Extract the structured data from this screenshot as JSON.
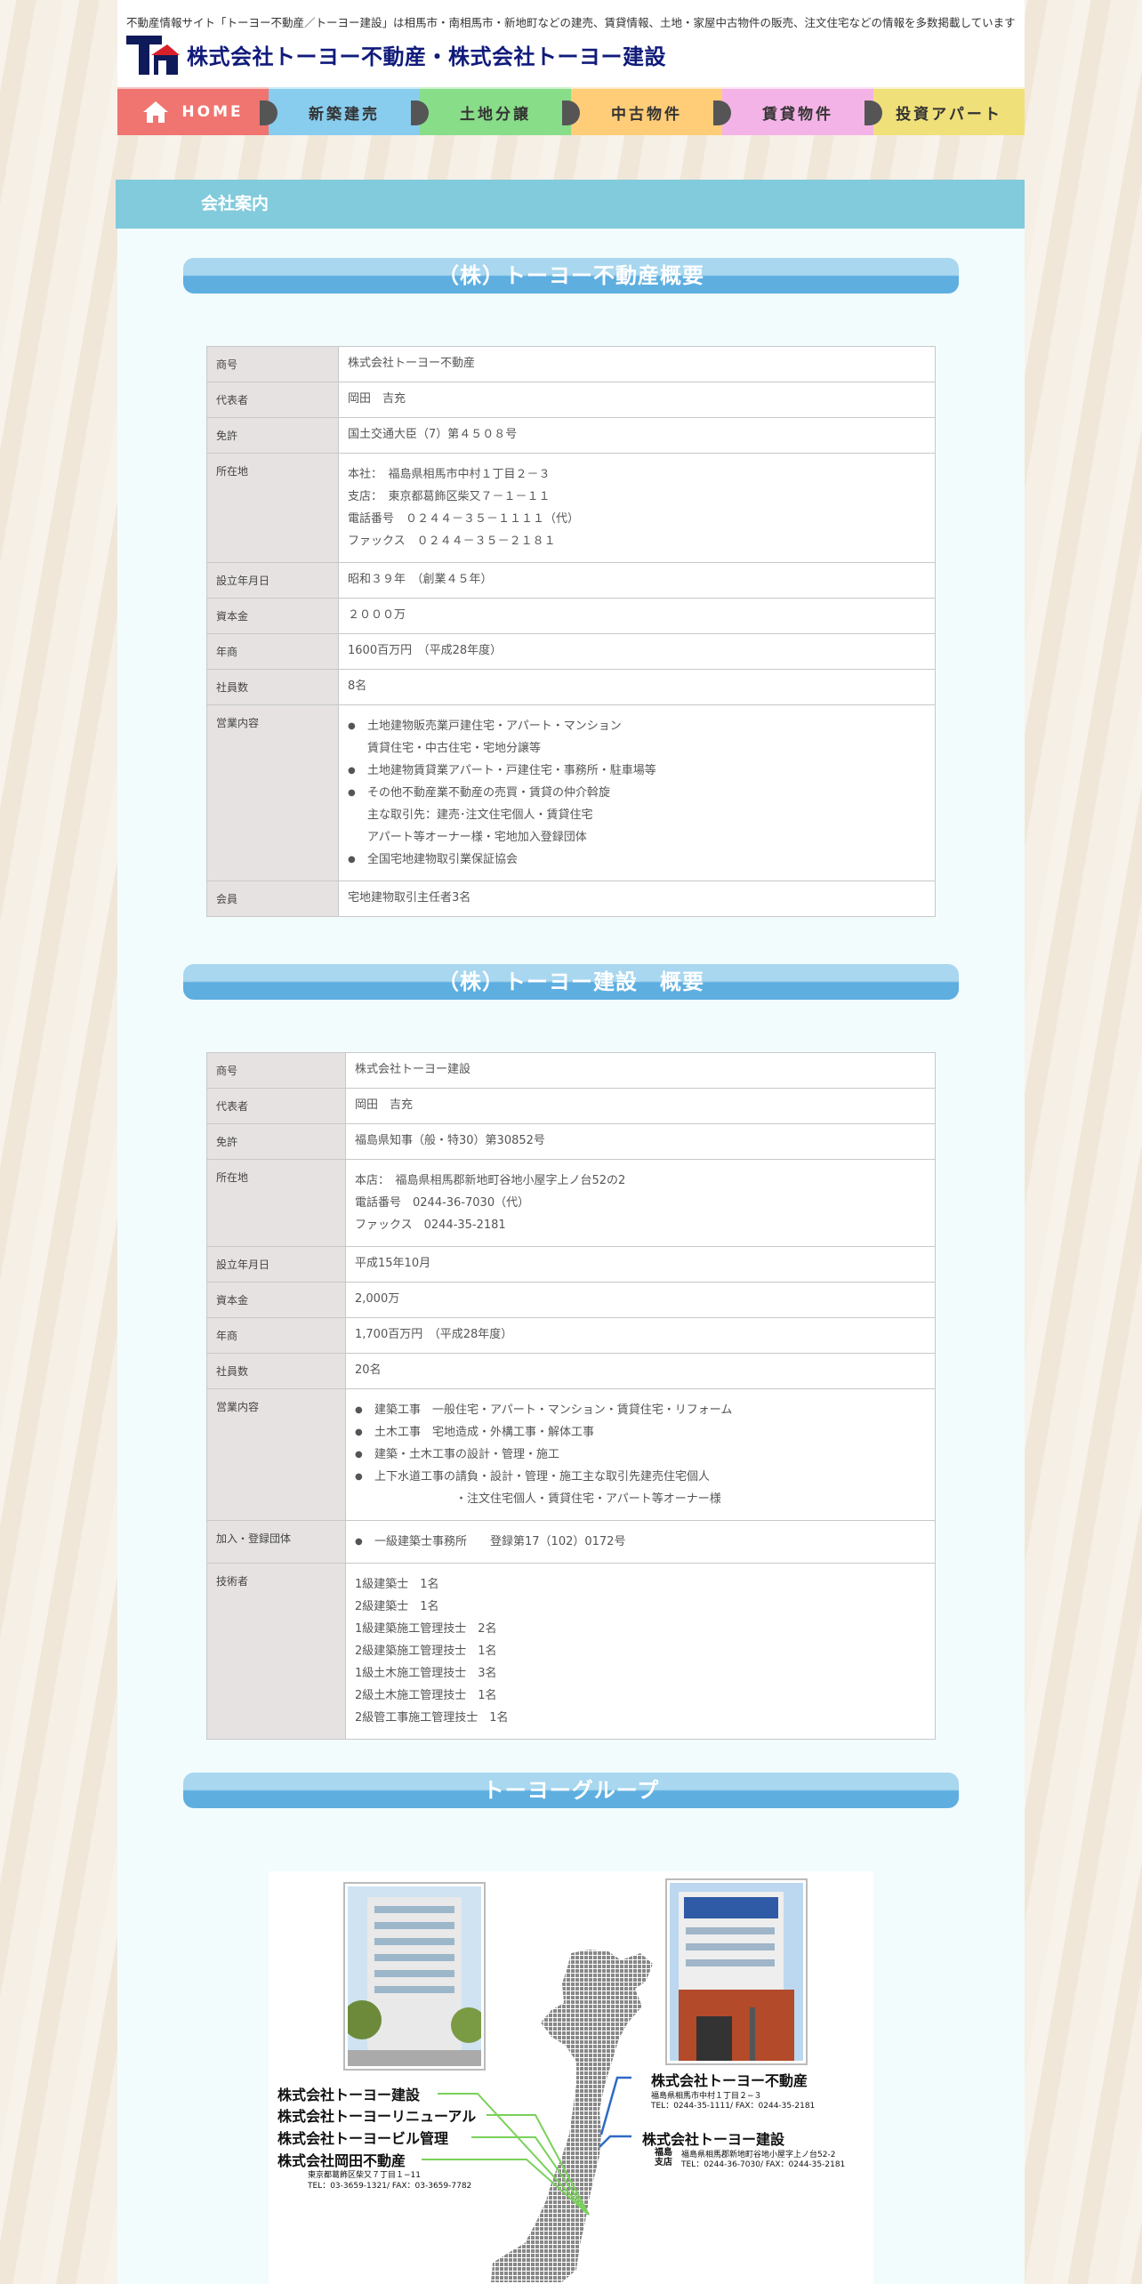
{
  "header": {
    "tagline": "不動産情報サイト「トーヨー不動産／トーヨー建設」は相馬市・南相馬市・新地町などの建売、賃貸情報、土地・家屋中古物件の販売、注文住宅などの情報を多数掲載しています",
    "title": "株式会社トーヨー不動産・株式会社トーヨー建設"
  },
  "nav": [
    {
      "label": "HOME",
      "color": "#f07470"
    },
    {
      "label": "新築建売",
      "color": "#88ccee"
    },
    {
      "label": "土地分譲",
      "color": "#88dd88"
    },
    {
      "label": "中古物件",
      "color": "#ffcc77"
    },
    {
      "label": "賃貸物件",
      "color": "#f4b3e6"
    },
    {
      "label": "投資アパート",
      "color": "#f0e07a"
    }
  ],
  "page_title": "会社案内",
  "fudosan": {
    "title": "（株）トーヨー不動産概要",
    "rows": [
      {
        "label": "商号",
        "lines": [
          "株式会社トーヨー不動産"
        ]
      },
      {
        "label": "代表者",
        "lines": [
          "岡田　吉充"
        ]
      },
      {
        "label": "免許",
        "lines": [
          "国土交通大臣（7）第４５０８号"
        ]
      },
      {
        "label": "所在地",
        "lines": [
          "本社：　福島県相馬市中村１丁目２－３",
          "支店：　東京都葛飾区柴又７－１－１１",
          "電話番号　０２４４－３５－１１１１（代）",
          "ファックス　０２４４－３５－２１８１"
        ]
      },
      {
        "label": "設立年月日",
        "lines": [
          "昭和３９年　（創業４５年）"
        ]
      },
      {
        "label": "資本金",
        "lines": [
          "２０００万"
        ]
      },
      {
        "label": "年商",
        "lines": [
          "1600百万円　（平成28年度）"
        ]
      },
      {
        "label": "社員数",
        "lines": [
          "8名"
        ]
      },
      {
        "label": "営業内容",
        "bullets": [
          {
            "b": true,
            "t": "土地建物販売業戸建住宅・アパート・マンション"
          },
          {
            "b": false,
            "t": "賃貸住宅・中古住宅・宅地分譲等"
          },
          {
            "b": true,
            "t": "土地建物賃貸業アパート・戸建住宅・事務所・駐車場等"
          },
          {
            "b": true,
            "t": "その他不動産業不動産の売買・賃貸の仲介斡旋"
          },
          {
            "b": false,
            "t": "主な取引先：建売･注文住宅個人・賃貸住宅"
          },
          {
            "b": false,
            "t": "アパート等オーナー様・宅地加入登録団体"
          },
          {
            "b": true,
            "t": "全国宅地建物取引業保証協会"
          }
        ]
      },
      {
        "label": "会員",
        "lines": [
          "宅地建物取引主任者3名"
        ]
      }
    ]
  },
  "kensetsu": {
    "title": "（株）トーヨー建設　概要",
    "rows": [
      {
        "label": "商号",
        "lines": [
          "株式会社トーヨー建設"
        ]
      },
      {
        "label": "代表者",
        "lines": [
          "岡田　吉充"
        ]
      },
      {
        "label": "免許",
        "lines": [
          "福島県知事（般・特30）第30852号"
        ]
      },
      {
        "label": "所在地",
        "lines": [
          "本店：　福島県相馬郡新地町谷地小屋字上ノ台52の2",
          "電話番号　0244-36-7030（代）",
          "ファックス　0244-35-2181"
        ]
      },
      {
        "label": "設立年月日",
        "lines": [
          "平成15年10月"
        ]
      },
      {
        "label": "資本金",
        "lines": [
          "2,000万"
        ]
      },
      {
        "label": "年商",
        "lines": [
          "1,700百万円　（平成28年度）"
        ]
      },
      {
        "label": "社員数",
        "lines": [
          "20名"
        ]
      },
      {
        "label": "営業内容",
        "bullets": [
          {
            "b": true,
            "t": "建築工事　一般住宅・アパート・マンション・賃貸住宅・リフォーム"
          },
          {
            "b": true,
            "t": "土木工事　宅地造成・外構工事・解体工事"
          },
          {
            "b": true,
            "t": "建築・土木工事の設計・管理・施工"
          },
          {
            "b": true,
            "t": "上下水道工事の請負・設計・管理・施工主な取引先建売住宅個人"
          },
          {
            "b": false,
            "t": "　　　　　　　・注文住宅個人・賃貸住宅・アパート等オーナー様"
          }
        ]
      },
      {
        "label": "加入・登録団体",
        "bullets": [
          {
            "b": true,
            "t": "一級建築士事務所　　登録第17（102）0172号"
          }
        ]
      },
      {
        "label": "技術者",
        "lines": [
          "1級建築士　1名",
          "2級建築士　1名",
          "1級建築施工管理技士　2名",
          "2級建築施工管理技士　1名",
          "1級土木施工管理技士　3名",
          "2級土木施工管理技士　1名",
          "2級管工事施工管理技士　1名"
        ]
      }
    ]
  },
  "group": {
    "title": "トーヨーグループ",
    "left_companies": [
      "株式会社トーヨー建設",
      "株式会社トーヨーリニューアル",
      "株式会社トーヨービル管理",
      "株式会社岡田不動産"
    ],
    "left_address": "東京都葛飾区柴又７丁目１−11",
    "left_tel": "TEL：03-3659-1321/ FAX：03-3659-7782",
    "right1_name": "株式会社トーヨー不動産",
    "right1_addr": "福島県相馬市中村１丁目２−３",
    "right1_tel": "TEL：0244-35-1111/ FAX：0244-35-2181",
    "right2_name": "株式会社トーヨー建設",
    "right2_branch": "福島\n支店",
    "right2_addr": "福島県相馬郡新地町谷地小屋字上ノ台52-2",
    "right2_tel": "TEL：0244-36-7030/ FAX：0244-35-2181"
  }
}
